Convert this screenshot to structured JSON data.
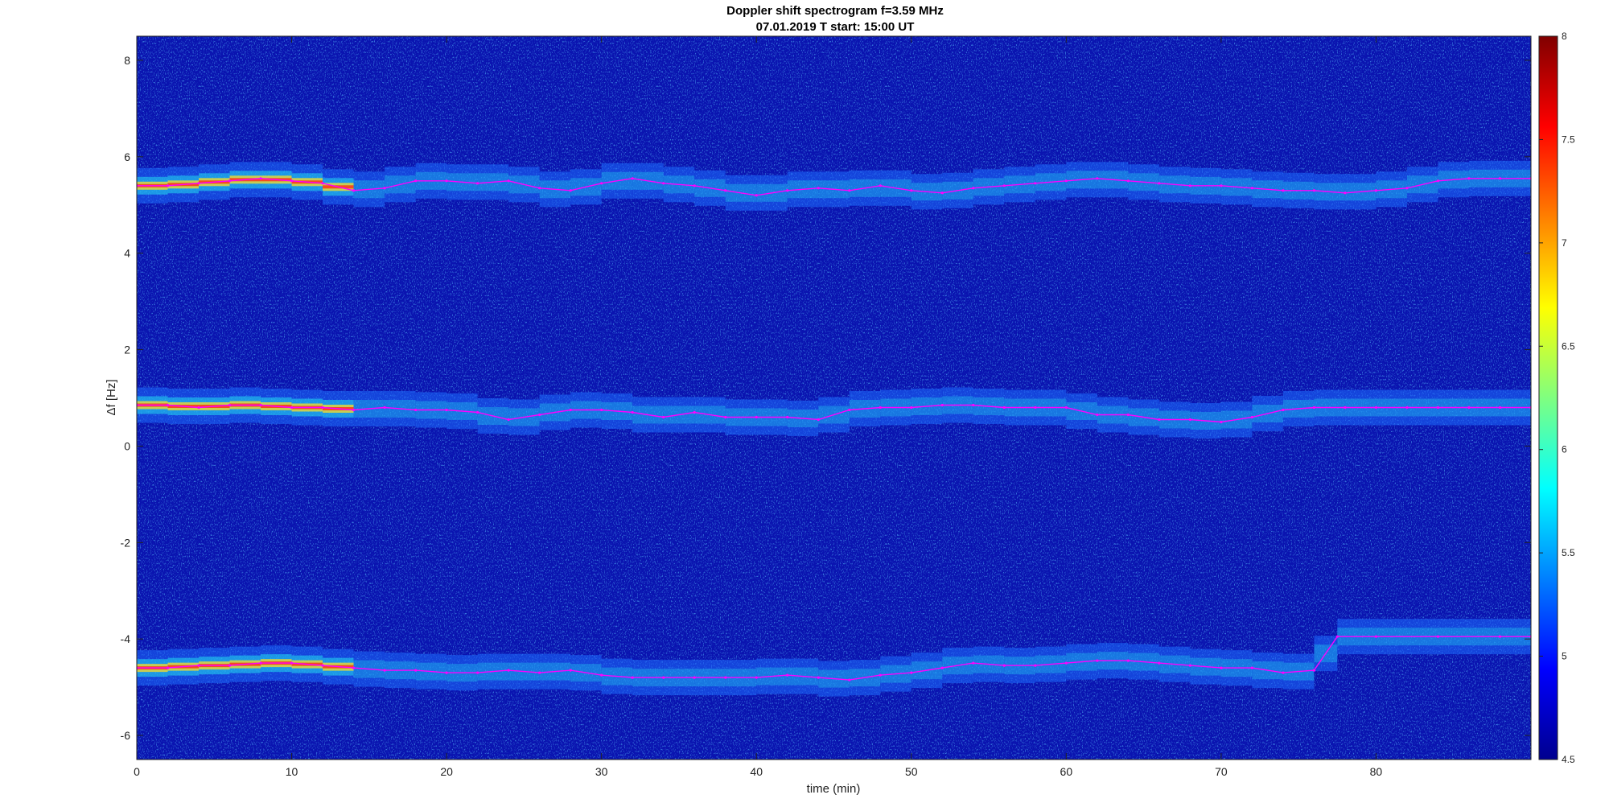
{
  "chart_data": {
    "type": "heatmap",
    "title": "Doppler shift spectrogram f=3.59 MHz",
    "subtitle": "07.01.2019   T start: 15:00 UT",
    "xlabel": "time (min)",
    "ylabel": "Δf [Hz]",
    "xlim": [
      0,
      90
    ],
    "ylim": [
      -6.5,
      8.5
    ],
    "xticks": [
      0,
      10,
      20,
      30,
      40,
      50,
      60,
      70,
      80
    ],
    "yticks": [
      -6,
      -4,
      -2,
      0,
      2,
      4,
      6,
      8
    ],
    "colorbar": {
      "colormap": "jet",
      "clim": [
        4.5,
        8
      ],
      "ticks": [
        "4.5",
        "5",
        "5.5",
        "6",
        "6.5",
        "7",
        "7.5",
        "8"
      ]
    },
    "background_color": "#0a14b0",
    "traces": [
      {
        "color": "#ff00ff",
        "points": [
          [
            0,
            5.4
          ],
          [
            2,
            5.4
          ],
          [
            4,
            5.45
          ],
          [
            6,
            5.5
          ],
          [
            8,
            5.55
          ],
          [
            10,
            5.5
          ],
          [
            12,
            5.45
          ],
          [
            14,
            5.3
          ],
          [
            16,
            5.35
          ],
          [
            18,
            5.5
          ],
          [
            20,
            5.5
          ],
          [
            22,
            5.45
          ],
          [
            24,
            5.5
          ],
          [
            26,
            5.35
          ],
          [
            28,
            5.3
          ],
          [
            30,
            5.45
          ],
          [
            32,
            5.55
          ],
          [
            34,
            5.45
          ],
          [
            36,
            5.4
          ],
          [
            38,
            5.3
          ],
          [
            40,
            5.2
          ],
          [
            42,
            5.3
          ],
          [
            44,
            5.35
          ],
          [
            46,
            5.3
          ],
          [
            48,
            5.4
          ],
          [
            50,
            5.3
          ],
          [
            52,
            5.25
          ],
          [
            54,
            5.35
          ],
          [
            56,
            5.4
          ],
          [
            58,
            5.45
          ],
          [
            60,
            5.5
          ],
          [
            62,
            5.55
          ],
          [
            64,
            5.5
          ],
          [
            66,
            5.45
          ],
          [
            68,
            5.4
          ],
          [
            70,
            5.4
          ],
          [
            72,
            5.35
          ],
          [
            74,
            5.3
          ],
          [
            76,
            5.3
          ],
          [
            78,
            5.25
          ],
          [
            80,
            5.3
          ],
          [
            82,
            5.35
          ],
          [
            84,
            5.5
          ],
          [
            86,
            5.55
          ],
          [
            88,
            5.55
          ],
          [
            90,
            5.55
          ]
        ]
      },
      {
        "color": "#ff00ff",
        "points": [
          [
            0,
            0.85
          ],
          [
            2,
            0.85
          ],
          [
            4,
            0.8
          ],
          [
            6,
            0.85
          ],
          [
            8,
            0.85
          ],
          [
            10,
            0.8
          ],
          [
            12,
            0.8
          ],
          [
            14,
            0.75
          ],
          [
            16,
            0.8
          ],
          [
            18,
            0.75
          ],
          [
            20,
            0.75
          ],
          [
            22,
            0.7
          ],
          [
            24,
            0.55
          ],
          [
            26,
            0.65
          ],
          [
            28,
            0.75
          ],
          [
            30,
            0.75
          ],
          [
            32,
            0.7
          ],
          [
            34,
            0.6
          ],
          [
            36,
            0.7
          ],
          [
            38,
            0.6
          ],
          [
            40,
            0.6
          ],
          [
            42,
            0.6
          ],
          [
            44,
            0.55
          ],
          [
            46,
            0.75
          ],
          [
            48,
            0.8
          ],
          [
            50,
            0.8
          ],
          [
            52,
            0.85
          ],
          [
            54,
            0.85
          ],
          [
            56,
            0.8
          ],
          [
            58,
            0.8
          ],
          [
            60,
            0.8
          ],
          [
            62,
            0.65
          ],
          [
            64,
            0.65
          ],
          [
            66,
            0.55
          ],
          [
            68,
            0.55
          ],
          [
            70,
            0.5
          ],
          [
            72,
            0.6
          ],
          [
            74,
            0.75
          ],
          [
            76,
            0.8
          ],
          [
            78,
            0.8
          ],
          [
            80,
            0.8
          ],
          [
            82,
            0.8
          ],
          [
            84,
            0.8
          ],
          [
            86,
            0.8
          ],
          [
            88,
            0.8
          ],
          [
            90,
            0.8
          ]
        ]
      },
      {
        "color": "#ff00ff",
        "points": [
          [
            0,
            -4.6
          ],
          [
            2,
            -4.6
          ],
          [
            4,
            -4.55
          ],
          [
            6,
            -4.55
          ],
          [
            8,
            -4.5
          ],
          [
            10,
            -4.5
          ],
          [
            12,
            -4.55
          ],
          [
            14,
            -4.6
          ],
          [
            16,
            -4.65
          ],
          [
            18,
            -4.65
          ],
          [
            20,
            -4.7
          ],
          [
            22,
            -4.7
          ],
          [
            24,
            -4.65
          ],
          [
            26,
            -4.7
          ],
          [
            28,
            -4.65
          ],
          [
            30,
            -4.75
          ],
          [
            32,
            -4.8
          ],
          [
            34,
            -4.8
          ],
          [
            36,
            -4.8
          ],
          [
            38,
            -4.8
          ],
          [
            40,
            -4.8
          ],
          [
            42,
            -4.75
          ],
          [
            44,
            -4.8
          ],
          [
            46,
            -4.85
          ],
          [
            48,
            -4.75
          ],
          [
            50,
            -4.7
          ],
          [
            52,
            -4.6
          ],
          [
            54,
            -4.5
          ],
          [
            56,
            -4.55
          ],
          [
            58,
            -4.55
          ],
          [
            60,
            -4.5
          ],
          [
            62,
            -4.45
          ],
          [
            64,
            -4.45
          ],
          [
            66,
            -4.5
          ],
          [
            68,
            -4.55
          ],
          [
            70,
            -4.6
          ],
          [
            72,
            -4.6
          ],
          [
            74,
            -4.7
          ],
          [
            76,
            -4.65
          ],
          [
            77.5,
            -3.95
          ],
          [
            80,
            -3.95
          ],
          [
            84,
            -3.95
          ],
          [
            88,
            -3.95
          ],
          [
            90,
            -3.95
          ]
        ]
      }
    ]
  }
}
